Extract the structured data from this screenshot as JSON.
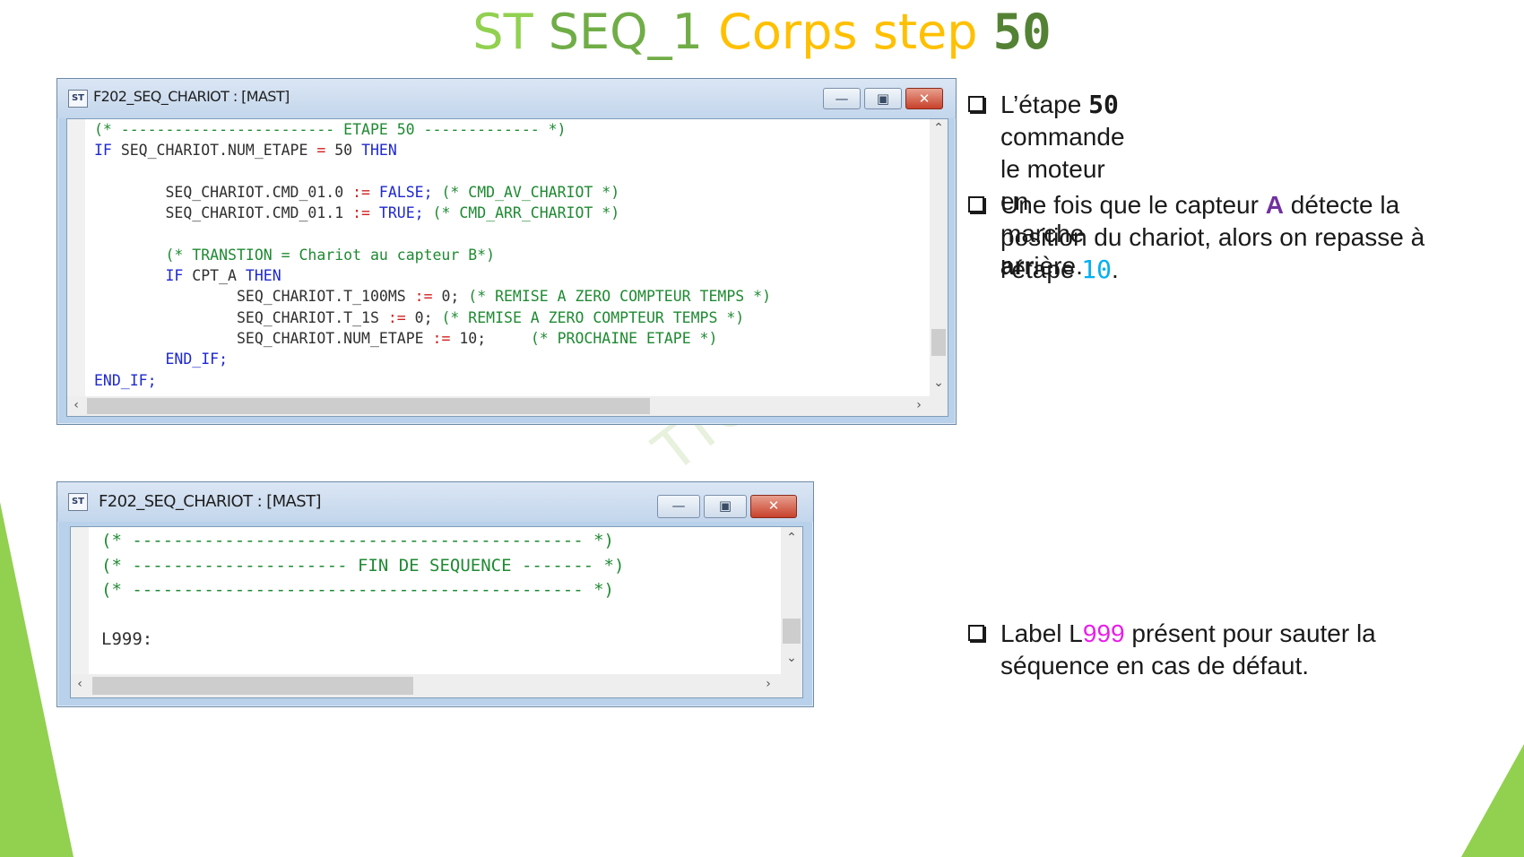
{
  "colors": {
    "accent_green": "#92d050",
    "corps_gold": "#ffc000",
    "keyword": "#1e28d0",
    "comment": "#1f8a32",
    "operator": "#d41c1c",
    "cyan": "#00b0f0",
    "purple": "#7030a0",
    "magenta": "#e81ee8"
  },
  "title": {
    "st": "ST",
    "seq": "SEQ_1",
    "corps": "Corps step",
    "num": "50"
  },
  "window1": {
    "title": "F202_SEQ_CHARIOT : [MAST]",
    "icon": "st-app-icon",
    "code": {
      "l1_comment": "(* ------------------------ ETAPE 50 ------------- *)",
      "l2_if": "IF",
      "l2_var": "SEQ_CHARIOT.NUM_ETAPE",
      "l2_eq": "=",
      "l2_val": "50",
      "l2_then": "THEN",
      "l4_var": "SEQ_CHARIOT.CMD_01.0",
      "l4_op": ":=",
      "l4_val": "FALSE;",
      "l4_comment": "(* CMD_AV_CHARIOT *)",
      "l5_var": "SEQ_CHARIOT.CMD_01.1",
      "l5_op": ":=",
      "l5_val": "TRUE;",
      "l5_comment": "(* CMD_ARR_CHARIOT *)",
      "l7_comment": "(* TRANSTION = Chariot au capteur B*)",
      "l8_if": "IF",
      "l8_var": "CPT_A",
      "l8_then": "THEN",
      "l9_var": "SEQ_CHARIOT.T_100MS",
      "l9_op": ":=",
      "l9_val": "0;",
      "l9_comment": "(* REMISE A ZERO COMPTEUR TEMPS *)",
      "l10_var": "SEQ_CHARIOT.T_1S",
      "l10_op": ":=",
      "l10_val": "0;",
      "l10_comment": "(* REMISE A ZERO COMPTEUR TEMPS *)",
      "l11_var": "SEQ_CHARIOT.NUM_ETAPE",
      "l11_op": ":=",
      "l11_val": "10;",
      "l11_comment": "(* PROCHAINE ETAPE *)",
      "l12_endif": "END_IF;",
      "l13_endif": "END_IF;"
    }
  },
  "window2": {
    "title": "F202_SEQ_CHARIOT : [MAST]",
    "icon": "st-app-icon",
    "code": {
      "l1_comment": "(* -------------------------------------------- *)",
      "l2_comment": "(* --------------------- FIN DE SEQUENCE ------- *)",
      "l3_comment": "(* -------------------------------------------- *)",
      "l5_label": "L999:"
    }
  },
  "bullets": {
    "b1": {
      "pre": "L’étape ",
      "num": "50",
      "post": " commande le moteur en",
      "line2_pre": "marche ",
      "bold": "arr",
      "line2_post": "ière."
    },
    "b2": {
      "line1_pre": "Une fois que le capteur ",
      "capteur": "A",
      "line1_post": " détecte la",
      "line2": "position du chariot, alors on repasse à",
      "line3_pre": "l’étape ",
      "num": "10",
      "line3_post": "."
    },
    "b3": {
      "line1_pre": "Label L",
      "num": "999",
      "line1_post": " présent pour sauter la",
      "line2": "séquence en cas de défaut."
    }
  }
}
